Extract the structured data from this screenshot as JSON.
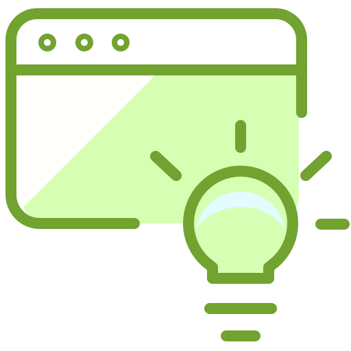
{
  "icon": {
    "name": "browser-window-idea-icon",
    "parts": [
      "browser-window-icon",
      "light-bulb-icon",
      "light-rays-icon"
    ]
  },
  "colors": {
    "stroke": "#72a22f",
    "window_fill": "#d6ffb3",
    "window_highlight": "#fffffd",
    "bulb_glass": "#e4fbff"
  }
}
